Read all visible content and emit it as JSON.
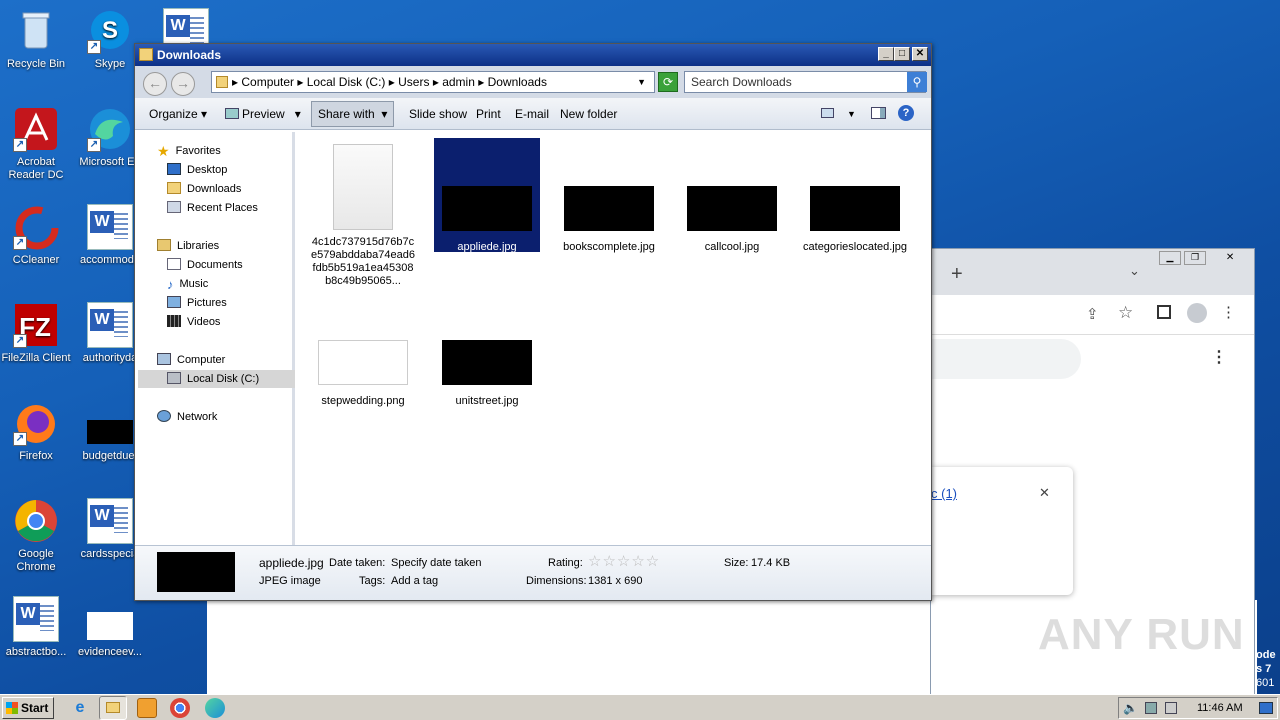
{
  "desktop": {
    "icons": [
      {
        "label": "Recycle Bin",
        "icon": "recycle-bin-icon"
      },
      {
        "label": "Skype",
        "icon": "skype-icon"
      },
      {
        "label": "Acrobat Reader DC",
        "icon": "acrobat-icon"
      },
      {
        "label": "Microsoft Ed",
        "icon": "edge-icon"
      },
      {
        "label": "CCleaner",
        "icon": "ccleaner-icon"
      },
      {
        "label": "accommoda",
        "icon": "word-doc-icon"
      },
      {
        "label": "FileZilla Client",
        "icon": "filezilla-icon"
      },
      {
        "label": "authorityda",
        "icon": "word-doc-icon"
      },
      {
        "label": "Firefox",
        "icon": "firefox-icon"
      },
      {
        "label": "budgetdue.",
        "icon": "image-file-icon"
      },
      {
        "label": "Google Chrome",
        "icon": "chrome-icon"
      },
      {
        "label": "cardsspecia",
        "icon": "word-doc-icon"
      },
      {
        "label": "abstractbo...",
        "icon": "word-doc-icon"
      },
      {
        "label": "evidenceev...",
        "icon": "image-file-icon"
      }
    ],
    "watermark": "ANY RUN",
    "edge_text_1": "ode",
    "edge_text_2": "s 7",
    "edge_text_3": "601"
  },
  "browser": {
    "new_tab_symbol": "+",
    "download_link": "c (1)",
    "close_symbol": "✕"
  },
  "explorer": {
    "title": "Downloads",
    "breadcrumb": [
      "Computer",
      "Local Disk (C:)",
      "Users",
      "admin",
      "Downloads"
    ],
    "search_placeholder": "Search Downloads",
    "commands": {
      "organize": "Organize",
      "preview": "Preview",
      "share_with": "Share with",
      "slide_show": "Slide show",
      "print": "Print",
      "email": "E-mail",
      "new_folder": "New folder"
    },
    "nav": {
      "favorites": "Favorites",
      "desktop": "Desktop",
      "downloads": "Downloads",
      "recent_places": "Recent Places",
      "libraries": "Libraries",
      "documents": "Documents",
      "music": "Music",
      "pictures": "Pictures",
      "videos": "Videos",
      "computer": "Computer",
      "local_disk": "Local Disk (C:)",
      "network": "Network"
    },
    "files": [
      {
        "name": "4c1dc737915d76b7ce579abddaba74ead6fdb5b519a1ea45308b8c49b95065...",
        "type": "blank"
      },
      {
        "name": "appliede.jpg",
        "type": "dark",
        "selected": true
      },
      {
        "name": "bookscomplete.jpg",
        "type": "dark"
      },
      {
        "name": "callcool.jpg",
        "type": "dark"
      },
      {
        "name": "categorieslocated.jpg",
        "type": "dark"
      },
      {
        "name": "stepwedding.png",
        "type": "light"
      },
      {
        "name": "unitstreet.jpg",
        "type": "dark"
      }
    ],
    "details": {
      "filename": "appliede.jpg",
      "filetype": "JPEG image",
      "date_taken_label": "Date taken:",
      "date_taken_value": "Specify date taken",
      "tags_label": "Tags:",
      "tags_value": "Add a tag",
      "rating_label": "Rating:",
      "rating_stars": 0,
      "dimensions_label": "Dimensions:",
      "dimensions_value": "1381 x 690",
      "size_label": "Size:",
      "size_value": "17.4 KB"
    }
  },
  "taskbar": {
    "start_label": "Start",
    "clock": "11:46 AM"
  }
}
